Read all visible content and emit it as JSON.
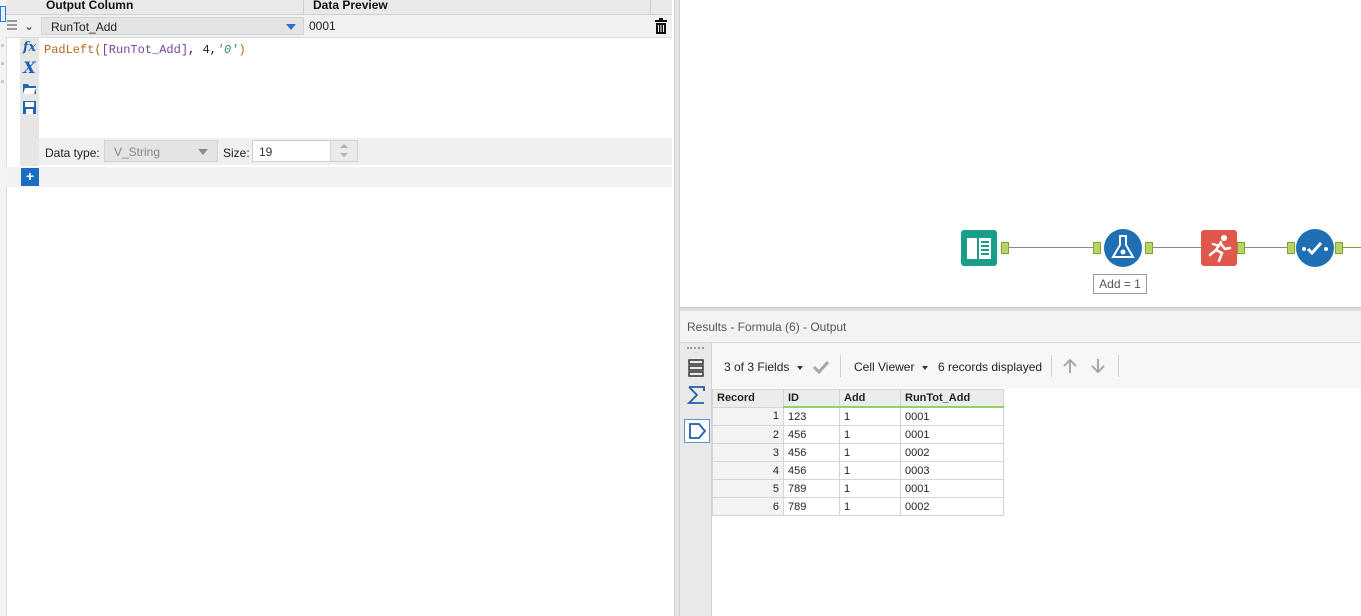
{
  "formula_panel": {
    "headers": {
      "output_column": "Output Column",
      "data_preview": "Data Preview"
    },
    "row": {
      "output_column": "RunTot_Add",
      "preview": "0001"
    },
    "expression": {
      "func": "PadLeft(",
      "field": "[RunTot_Add]",
      "sep": ", ",
      "num": "4",
      "comma": ",",
      "str": "'0'",
      "close": ")"
    },
    "data_type": {
      "label": "Data type:",
      "value": "V_String"
    },
    "size": {
      "label": "Size:",
      "value": "19"
    },
    "add_label": "+"
  },
  "workflow": {
    "annotation": "Add = 1",
    "tools": [
      "input-data-icon",
      "formula-icon",
      "running-total-icon",
      "select-icon"
    ],
    "colors": {
      "input": "#1a9e8c",
      "formula": "#1f6fb5",
      "running": "#e0574c",
      "select": "#1f6fb5",
      "anchor": "#b7d46a"
    }
  },
  "results": {
    "title": "Results - Formula (6) - Output",
    "fields": "3 of 3 Fields",
    "viewer": "Cell Viewer",
    "records": "6 records displayed",
    "columns": [
      "Record",
      "ID",
      "Add",
      "RunTot_Add"
    ],
    "rows": [
      [
        "1",
        "123",
        "1",
        "0001"
      ],
      [
        "2",
        "456",
        "1",
        "0001"
      ],
      [
        "3",
        "456",
        "1",
        "0002"
      ],
      [
        "4",
        "456",
        "1",
        "0003"
      ],
      [
        "5",
        "789",
        "1",
        "0001"
      ],
      [
        "6",
        "789",
        "1",
        "0002"
      ]
    ]
  }
}
